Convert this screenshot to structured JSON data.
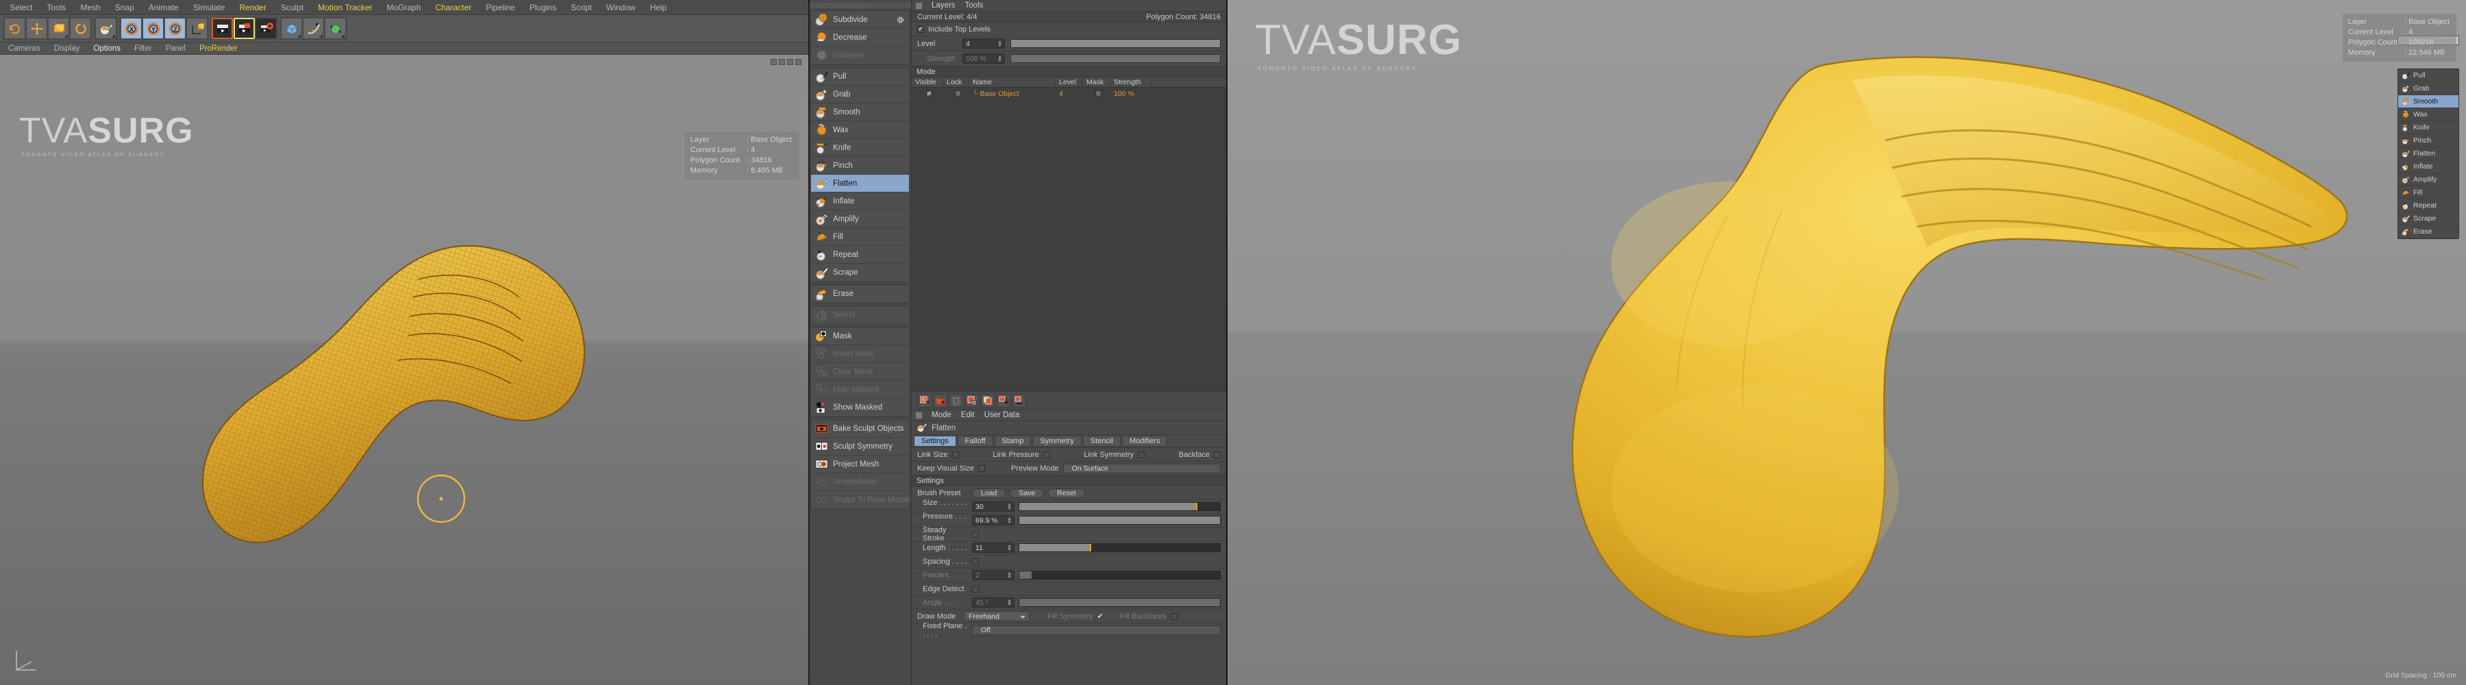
{
  "app": {
    "menubar": [
      {
        "label": "Select",
        "hl": false
      },
      {
        "label": "Tools",
        "hl": false
      },
      {
        "label": "Mesh",
        "hl": false
      },
      {
        "label": "Snap",
        "hl": false
      },
      {
        "label": "Animate",
        "hl": false
      },
      {
        "label": "Simulate",
        "hl": false
      },
      {
        "label": "Render",
        "hl": true
      },
      {
        "label": "Sculpt",
        "hl": false
      },
      {
        "label": "Motion Tracker",
        "hl": true
      },
      {
        "label": "MoGraph",
        "hl": false
      },
      {
        "label": "Character",
        "hl": true
      },
      {
        "label": "Pipeline",
        "hl": false
      },
      {
        "label": "Plugins",
        "hl": false
      },
      {
        "label": "Script",
        "hl": false
      },
      {
        "label": "Window",
        "hl": false
      },
      {
        "label": "Help",
        "hl": false
      }
    ],
    "viewport_menu": [
      {
        "label": "Cameras",
        "state": "normal"
      },
      {
        "label": "Display",
        "state": "normal"
      },
      {
        "label": "Options",
        "state": "selected"
      },
      {
        "label": "Filter",
        "state": "normal"
      },
      {
        "label": "Panel",
        "state": "normal"
      },
      {
        "label": "ProRender",
        "state": "on"
      }
    ],
    "toolbar_icons": [
      "undo-icon",
      "live-selection-icon",
      "move-icon",
      "scale-icon",
      "rotate-icon",
      "cursor-paint-icon",
      "axis-x-icon",
      "axis-y-icon",
      "axis-z-icon",
      "world-coord-icon",
      "render-view-icon",
      "render-region-icon",
      "render-settings-icon",
      "cube-primitive-icon",
      "spline-pen-icon",
      "nurbs-icon",
      "array-icon",
      "deformer-icon",
      "environment-icon",
      "camera-icon",
      "light-icon"
    ]
  },
  "left_viewport": {
    "logo": {
      "brand_light": "TVA",
      "brand_bold": "SURG",
      "tagline": "TORONTO VIDEO ATLAS OF SURGERY"
    },
    "info": {
      "headers": [
        "Layer",
        "Current Level",
        "Polygon Count",
        "Memory"
      ],
      "values": [
        "Base Object",
        "4",
        "34816",
        "8.495 MB"
      ]
    }
  },
  "right_viewport": {
    "logo": {
      "brand_light": "TVA",
      "brand_bold": "SURG",
      "tagline": "TORONTO VIDEO ATLAS OF SURGERY"
    },
    "info": {
      "headers": [
        "Layer",
        "Current Level",
        "Polygon Count",
        "Memory"
      ],
      "values": [
        "Base Object",
        "4",
        "105216",
        "22.546 MB"
      ]
    },
    "grid_spacing": "Grid Spacing : 100 cm",
    "mini_palette": [
      {
        "label": "Pull",
        "state": "normal",
        "icon": "brush-pull-icon"
      },
      {
        "label": "Grab",
        "state": "normal",
        "icon": "brush-grab-icon"
      },
      {
        "label": "Smooth",
        "state": "selected",
        "icon": "brush-smooth-icon"
      },
      {
        "label": "Wax",
        "state": "normal",
        "icon": "brush-wax-icon"
      },
      {
        "label": "Knife",
        "state": "normal",
        "icon": "brush-knife-icon"
      },
      {
        "label": "Pinch",
        "state": "normal",
        "icon": "brush-pinch-icon"
      },
      {
        "label": "Flatten",
        "state": "normal",
        "icon": "brush-flatten-icon"
      },
      {
        "label": "Inflate",
        "state": "normal",
        "icon": "brush-inflate-icon"
      },
      {
        "label": "Amplify",
        "state": "normal",
        "icon": "brush-amplify-icon"
      },
      {
        "label": "Fill",
        "state": "normal",
        "icon": "brush-fill-icon"
      },
      {
        "label": "Repeat",
        "state": "normal",
        "icon": "brush-repeat-icon"
      },
      {
        "label": "Scrape",
        "state": "normal",
        "icon": "brush-scrape-icon"
      },
      {
        "label": "Erase",
        "state": "normal",
        "icon": "brush-erase-icon"
      }
    ]
  },
  "sculpt_palette": {
    "groups": [
      {
        "items": [
          {
            "label": "Subdivide",
            "state": "normal",
            "icon": "subdivide-icon",
            "gear": true
          },
          {
            "label": "Decrease",
            "state": "normal",
            "icon": "decrease-icon",
            "gear": false
          },
          {
            "label": "Increase",
            "state": "disabled",
            "icon": "increase-icon",
            "gear": false
          }
        ]
      },
      {
        "items": [
          {
            "label": "Pull",
            "state": "normal",
            "icon": "brush-pull-icon",
            "gear": false
          },
          {
            "label": "Grab",
            "state": "normal",
            "icon": "brush-grab-icon",
            "gear": false
          },
          {
            "label": "Smooth",
            "state": "normal",
            "icon": "brush-smooth-icon",
            "gear": false
          },
          {
            "label": "Wax",
            "state": "normal",
            "icon": "brush-wax-icon",
            "gear": false
          },
          {
            "label": "Knife",
            "state": "normal",
            "icon": "brush-knife-icon",
            "gear": false
          },
          {
            "label": "Pinch",
            "state": "normal",
            "icon": "brush-pinch-icon",
            "gear": false
          },
          {
            "label": "Flatten",
            "state": "selected",
            "icon": "brush-flatten-icon",
            "gear": false
          },
          {
            "label": "Inflate",
            "state": "normal",
            "icon": "brush-inflate-icon",
            "gear": false
          },
          {
            "label": "Amplify",
            "state": "normal",
            "icon": "brush-amplify-icon",
            "gear": false
          },
          {
            "label": "Fill",
            "state": "normal",
            "icon": "brush-fill-icon",
            "gear": false
          },
          {
            "label": "Repeat",
            "state": "normal",
            "icon": "brush-repeat-icon",
            "gear": false
          },
          {
            "label": "Scrape",
            "state": "normal",
            "icon": "brush-scrape-icon",
            "gear": false
          }
        ]
      },
      {
        "items": [
          {
            "label": "Erase",
            "state": "normal",
            "icon": "brush-erase-icon",
            "gear": false
          }
        ]
      },
      {
        "items": [
          {
            "label": "Select",
            "state": "disabled",
            "icon": "select-icon",
            "gear": false
          }
        ]
      },
      {
        "items": [
          {
            "label": "Mask",
            "state": "normal",
            "icon": "mask-icon",
            "gear": false
          },
          {
            "label": "Invert Mask",
            "state": "disabled",
            "icon": "invert-mask-icon",
            "gear": false
          },
          {
            "label": "Clear Mask",
            "state": "disabled",
            "icon": "clear-mask-icon",
            "gear": false
          },
          {
            "label": "Hide Masked",
            "state": "disabled",
            "icon": "hide-masked-icon",
            "gear": false
          },
          {
            "label": "Show Masked",
            "state": "normal",
            "icon": "show-masked-icon",
            "gear": false
          }
        ]
      },
      {
        "items": [
          {
            "label": "Bake Sculpt Objects",
            "state": "normal",
            "icon": "bake-sculpt-icon",
            "gear": false
          },
          {
            "label": "Sculpt Symmetry",
            "state": "normal",
            "icon": "sculpt-symmetry-icon",
            "gear": false
          },
          {
            "label": "Project Mesh",
            "state": "normal",
            "icon": "project-mesh-icon",
            "gear": false
          },
          {
            "label": "Unsubdivide",
            "state": "disabled",
            "icon": "unsubdivide-icon",
            "gear": false
          },
          {
            "label": "Sculpt To Pose Morph",
            "state": "disabled",
            "icon": "pose-morph-icon",
            "gear": false
          }
        ]
      }
    ]
  },
  "layers_panel": {
    "menu": [
      "Layers",
      "Tools"
    ],
    "status_left": "Current Level: 4/4",
    "status_right": "Polygon Count: 34816",
    "include_top_levels": {
      "label": "Include Top Levels",
      "checked": true
    },
    "level": {
      "label": "Level",
      "value": "4"
    },
    "strength": {
      "label": "Strength",
      "value": "100 %",
      "disabled": true
    },
    "mode_header": "Mode",
    "table": {
      "columns": [
        "Visible",
        "Lock",
        "Name",
        "Level",
        "Mask",
        "Strength"
      ],
      "rows": [
        {
          "visible": true,
          "lock": false,
          "name": "Base Object",
          "level": "4",
          "mask": false,
          "strength": "100 %"
        }
      ]
    }
  },
  "attributes_panel": {
    "icons": [
      "add-sculpt-layer-icon",
      "add-folder-icon",
      "delete-icon",
      "clear-layer-icon",
      "copy-layer-icon",
      "merge-down-icon",
      "flatten-layer-icon"
    ],
    "menu": [
      "Mode",
      "Edit",
      "User Data"
    ],
    "object_name": "Flatten",
    "tabs": [
      {
        "label": "Settings",
        "active": true
      },
      {
        "label": "Falloff",
        "active": false
      },
      {
        "label": "Stamp",
        "active": false
      },
      {
        "label": "Symmetry",
        "active": false
      },
      {
        "label": "Stencil",
        "active": false
      },
      {
        "label": "Modifiers",
        "active": false
      }
    ],
    "link_row": [
      {
        "label": "Link Size",
        "checked": false
      },
      {
        "label": "Link Pressure",
        "checked": false
      },
      {
        "label": "Link Symmetry",
        "checked": false
      },
      {
        "label": "Backface",
        "checked": false
      }
    ],
    "keep_visual_size": {
      "label": "Keep Visual Size",
      "checked": false
    },
    "preview_mode": {
      "label": "Preview Mode",
      "value": "On Surface"
    },
    "settings_header": "Settings",
    "brush_preset": {
      "label": "Brush Preset",
      "buttons": [
        "Load",
        "Save",
        "Reset"
      ]
    },
    "sliders": [
      {
        "label": "Size . . . . . . . .",
        "value": "30",
        "fill": 88,
        "disabled": false
      },
      {
        "label": "Pressure . . . .",
        "value": "69.9 %",
        "fill": 100,
        "disabled": false
      }
    ],
    "steady_stroke": {
      "label": "Steady Stroke",
      "checked": false
    },
    "length": {
      "label": "Length . . . . .",
      "value": "11",
      "fill": 35,
      "disabled": false
    },
    "spacing": {
      "label": "Spacing . . . .",
      "checked": false
    },
    "percent": {
      "label": "Percent. . . . .",
      "value": "2",
      "fill": 6,
      "disabled": true
    },
    "edge_detect": {
      "label": "Edge Detect",
      "checked": false
    },
    "angle": {
      "label": "Angle . . . . .",
      "value": "45 °",
      "fill": 100,
      "disabled": true
    },
    "draw_mode": {
      "label": "Draw Mode",
      "value": "Freehand"
    },
    "fill_symmetry": {
      "label": "Fill Symmetry",
      "checked": true
    },
    "fill_backfaces": {
      "label": "Fill Backfaces",
      "checked": false
    },
    "fixed_plane": {
      "label": "Fixed Plane . . . . .",
      "value": "Off"
    }
  },
  "colors": {
    "accent_orange": "#e09a3c",
    "select_blue": "#8aa6cc",
    "menu_highlight": "#e8d24a",
    "model_yellow": "#e8c13a",
    "panel_bg": "#4a4a4a"
  }
}
